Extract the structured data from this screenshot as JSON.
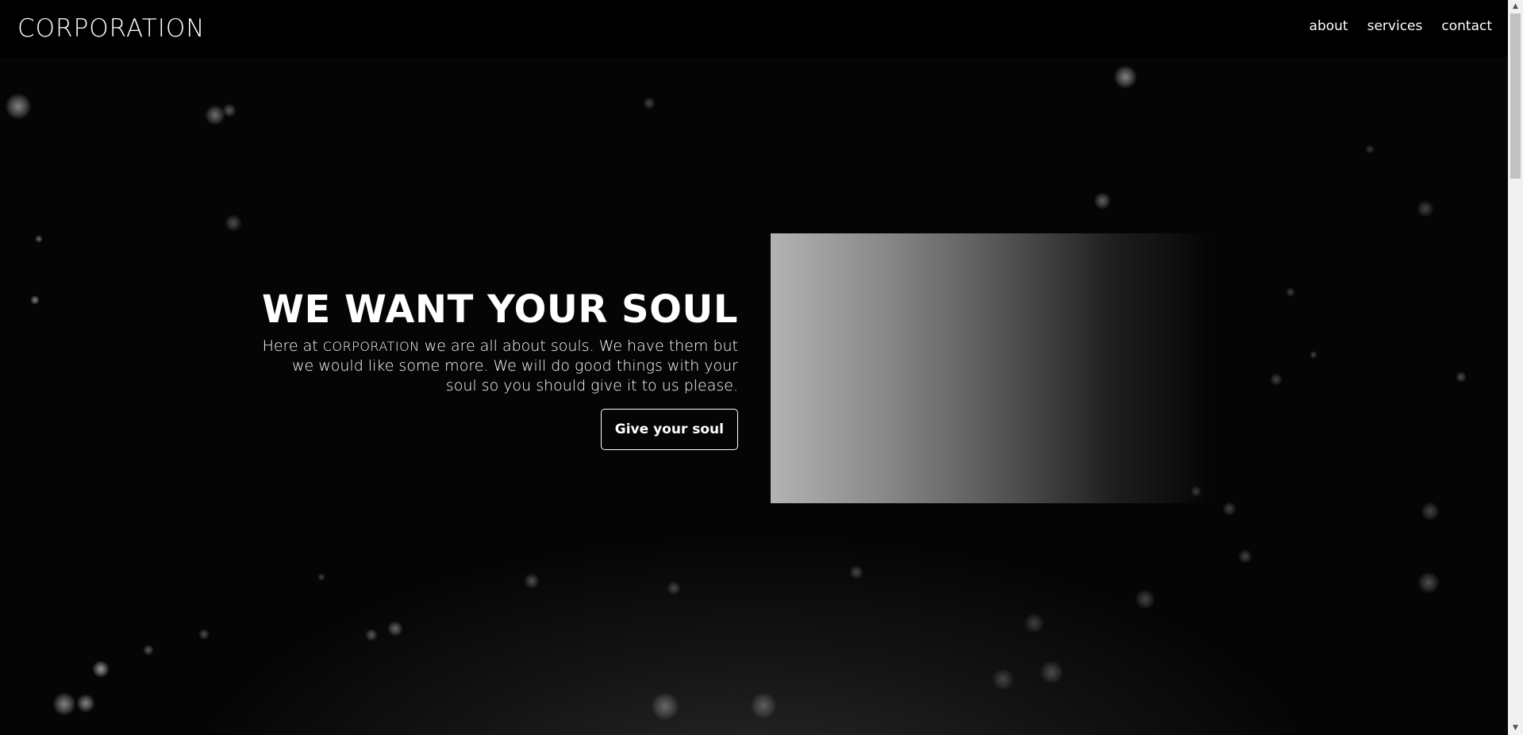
{
  "header": {
    "logo": "CORPORATION",
    "nav": [
      "about",
      "services",
      "contact"
    ]
  },
  "hero": {
    "title": "WE WANT YOUR SOUL",
    "body_before": "Here at ",
    "body_logo": "CORPORATION",
    "body_after": " we are all about souls. We have them but we would like some more. We will do good things with your soul so you should give it to us please.",
    "cta_label": "Give your soul"
  },
  "scrollbar": {
    "up_icon": "triangle-up",
    "down_icon": "triangle-down"
  }
}
